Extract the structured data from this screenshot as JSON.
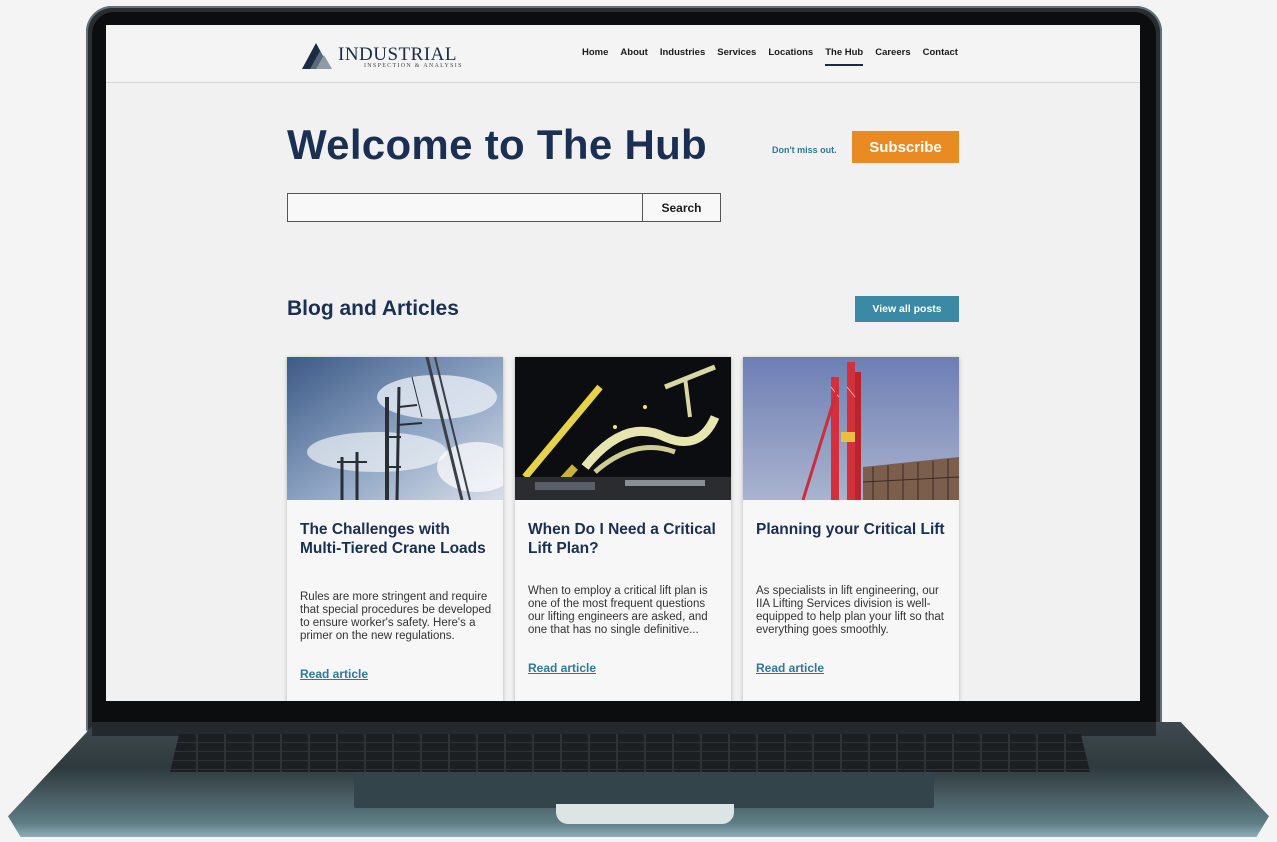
{
  "brand": {
    "name": "INDUSTRIAL",
    "subtitle": "INSPECTION & ANALYSIS",
    "navy": "#1a2f52",
    "orange": "#e98a23",
    "teal": "#3a8aa5"
  },
  "nav": {
    "items": [
      {
        "label": "Home"
      },
      {
        "label": "About"
      },
      {
        "label": "Industries"
      },
      {
        "label": "Services"
      },
      {
        "label": "Locations"
      },
      {
        "label": "The Hub",
        "active": true
      },
      {
        "label": "Careers"
      },
      {
        "label": "Contact"
      }
    ]
  },
  "hero": {
    "title": "Welcome to The Hub",
    "tagline": "Don't miss out.",
    "subscribe_label": "Subscribe"
  },
  "search": {
    "value": "",
    "placeholder": "",
    "button_label": "Search"
  },
  "blog": {
    "heading": "Blog and Articles",
    "view_all_label": "View all posts",
    "cards": [
      {
        "title": "The Challenges with Multi-Tiered Crane Loads",
        "excerpt": "Rules are more stringent and require that special procedures be developed to ensure worker's safety. Here's a primer on the new regulations.",
        "link_label": "Read article",
        "image": "crane-sky-photo"
      },
      {
        "title": "When Do I Need a Critical Lift Plan?",
        "excerpt": "When to employ a critical lift plan is one of the most frequent questions our lifting engineers are asked, and one that has no single definitive...",
        "link_label": "Read article",
        "image": "night-lift-photo"
      },
      {
        "title": "Planning your Critical Lift",
        "excerpt": "As specialists in lift engineering, our IIA Lifting Services division is well-equipped to help plan your lift so that everything goes smoothly.",
        "link_label": "Read article",
        "image": "red-crane-photo"
      }
    ]
  }
}
